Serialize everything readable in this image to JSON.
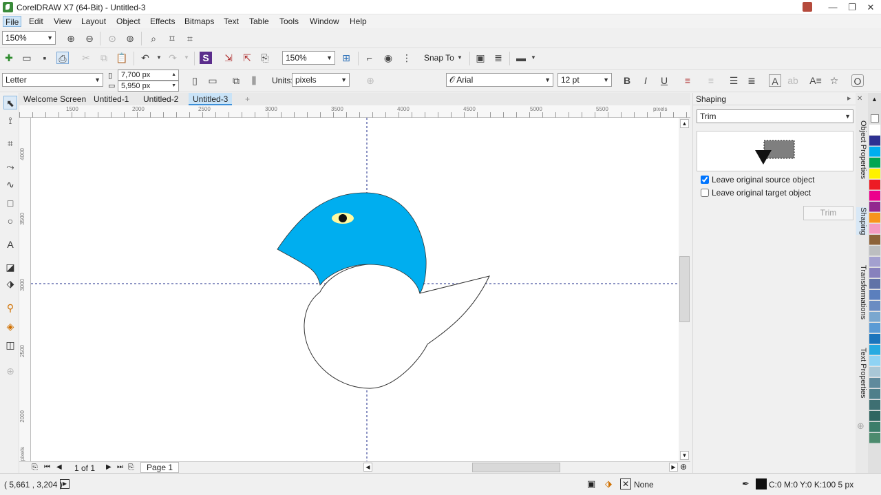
{
  "window": {
    "title": "CorelDRAW X7 (64-Bit) - Untitled-3",
    "minimize_glyph": "—",
    "restore_glyph": "❐",
    "close_glyph": "✕"
  },
  "menu": [
    "File",
    "Edit",
    "View",
    "Layout",
    "Object",
    "Effects",
    "Bitmaps",
    "Text",
    "Table",
    "Tools",
    "Window",
    "Help"
  ],
  "toolbar1": {
    "zoom_value": "150%"
  },
  "toolbar2": {
    "zoom_value": "150%",
    "snap_to_label": "Snap To"
  },
  "property_bar": {
    "page_size": "Letter",
    "width": "7,700 px",
    "height": "5,950 px",
    "units_label": "Units:",
    "units_value": "pixels",
    "font_name": "Arial",
    "font_size": "12 pt"
  },
  "doc_tabs": [
    "Welcome Screen",
    "Untitled-1",
    "Untitled-2",
    "Untitled-3"
  ],
  "ruler": {
    "top_labels": [
      "1500",
      "2000",
      "2500",
      "3000",
      "3500",
      "4000",
      "4500",
      "5000",
      "5500"
    ],
    "top_unit": "pixels",
    "left_labels": [
      "4000",
      "3500",
      "3000",
      "2500",
      "2000"
    ],
    "left_unit": "pixels"
  },
  "page_nav": {
    "page_count": "1 of 1",
    "page_tab": "Page 1"
  },
  "docker": {
    "title": "Shaping",
    "operation": "Trim",
    "opt_leave_source": "Leave original source object",
    "opt_leave_source_checked": true,
    "opt_leave_target": "Leave original target object",
    "opt_leave_target_checked": false,
    "action_button": "Trim"
  },
  "docker_tabs": [
    "Object Properties",
    "Shaping",
    "Transformations",
    "Text Properties"
  ],
  "palette_colors": [
    "#ffffff",
    "#2e3192",
    "#00aeef",
    "#00a651",
    "#fff200",
    "#ed1c24",
    "#ec008c",
    "#92278f",
    "#f7941d",
    "#f49ac1",
    "#8c6239",
    "#bcbec0",
    "#a3a0cf",
    "#8781bd",
    "#6173a7",
    "#5b7fbd",
    "#6b8cc2",
    "#7aa7cf",
    "#5b9bd5",
    "#1c75bc",
    "#27aae1",
    "#8fd3f4",
    "#a9c7d6",
    "#5f8a9c",
    "#4e7f8a",
    "#3e6f72",
    "#2f6661",
    "#3b7d6a",
    "#4c8b6e"
  ],
  "status": {
    "coords": "( 5,661 , 3,204 )",
    "fill_label": "None",
    "outline_info": "C:0 M:0 Y:0 K:100  5 px"
  },
  "colors": {
    "shape_blue": "#00aeef",
    "eye_yellow": "#fff9a0",
    "active_tab": "#c9e3f7"
  }
}
